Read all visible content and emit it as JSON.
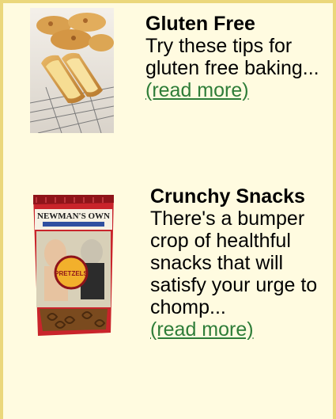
{
  "items": [
    {
      "image_subject": "gluten-free-bread-image",
      "title": "Gluten Free",
      "description": "Try these tips for gluten free baking...",
      "link_label": "(read more)"
    },
    {
      "image_subject": "pretzel-bag-image",
      "title": "Crunchy Snacks",
      "description": "There's a bumper crop of healthful snacks that will satisfy your urge to chomp...",
      "link_label": "(read more)",
      "package_brand": "NEWMAN'S OWN",
      "package_product": "PRETZELS"
    }
  ],
  "colors": {
    "frame_border": "#ebd77b",
    "frame_background": "#fffbe0",
    "link": "#2e7d38"
  }
}
